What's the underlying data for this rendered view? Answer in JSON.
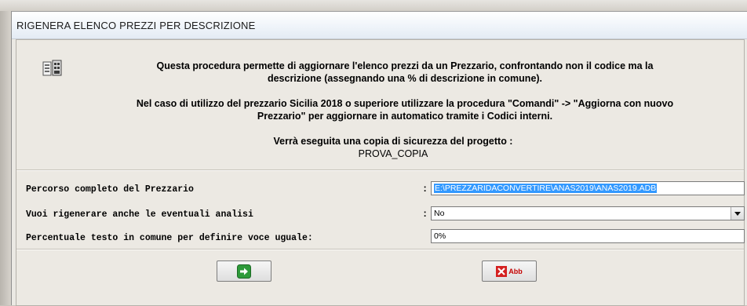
{
  "window": {
    "title": "RIGENERA ELENCO PREZZI PER DESCRIZIONE"
  },
  "intro": {
    "line1": "Questa procedura permette di aggiornare l'elenco prezzi da un Prezzario, confrontando non il codice ma la",
    "line2": "descrizione (assegnando una % di descrizione in comune).",
    "note1": "Nel caso di utilizzo del prezzario Sicilia 2018 o superiore utilizzare la procedura \"Comandi\" -> \"Aggiorna con nuovo",
    "note2": "Prezzario\" per aggiornare in automatico tramite i Codici interni.",
    "backup_label": "Verrà eseguita una copia di sicurezza del progetto :",
    "backup_name": "PROVA_COPIA"
  },
  "form": {
    "path_label": "Percorso completo del Prezzario",
    "path_value": "E:\\PREZZARIDACONVERTIRE\\ANAS2019\\ANAS2019.ADB",
    "regen_label": "Vuoi rigenerare anche le eventuali analisi",
    "regen_value": "No",
    "percent_label": "Percentuale testo in comune per definire voce uguale:",
    "percent_value": "0%",
    "colon": ":"
  },
  "buttons": {
    "ok_icon": "green-arrow-icon",
    "cancel_label": "Abb",
    "cancel_icon": "red-x-icon"
  },
  "colors": {
    "selection": "#3399ff",
    "ok_green": "#2e9a3a",
    "cancel_red": "#d42020"
  }
}
